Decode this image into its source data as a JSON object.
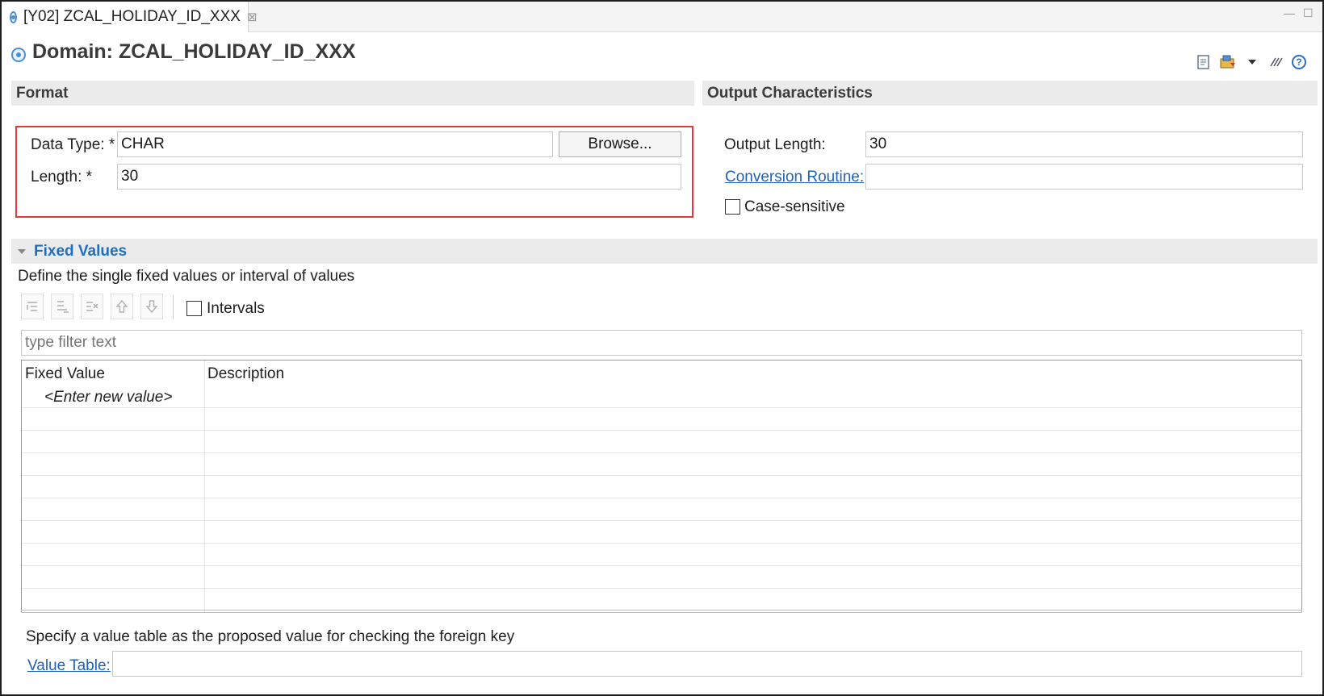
{
  "tab": {
    "title": "[Y02] ZCAL_HOLIDAY_ID_XXX",
    "close_glyph": "⊠"
  },
  "header": {
    "title": "Domain: ZCAL_HOLIDAY_ID_XXX",
    "tools": [
      "document-icon",
      "transport-icon",
      "dropdown-arrow-icon",
      "link-editor-icon",
      "help-icon"
    ],
    "help_glyph": "?"
  },
  "format": {
    "section_title": "Format",
    "data_type_label": "Data Type: *",
    "data_type_value": "CHAR",
    "browse_label": "Browse...",
    "length_label": "Length: *",
    "length_value": "30"
  },
  "output": {
    "section_title": "Output Characteristics",
    "output_length_label": "Output Length:",
    "output_length_value": "30",
    "conversion_routine_label": "Conversion Routine:",
    "conversion_routine_value": "",
    "case_sensitive_label": "Case-sensitive",
    "case_sensitive_checked": false
  },
  "fixed_values": {
    "section_title": "Fixed Values",
    "description": "Define the single fixed values or interval of values",
    "toolbar": [
      "add-single-value-icon",
      "add-interval-icon",
      "remove-value-icon",
      "move-up-icon",
      "move-down-icon"
    ],
    "intervals_label": "Intervals",
    "intervals_checked": false,
    "filter_placeholder": "type filter text",
    "columns": [
      "Fixed Value",
      "Description"
    ],
    "new_value_placeholder": "<Enter new value>"
  },
  "value_table": {
    "description": "Specify a value table as the proposed value for checking the foreign key",
    "label": "Value Table:",
    "value": ""
  },
  "colors": {
    "accent_link": "#1f63b8",
    "highlight_border": "#e03a3a",
    "section_bg": "#ebebeb"
  }
}
